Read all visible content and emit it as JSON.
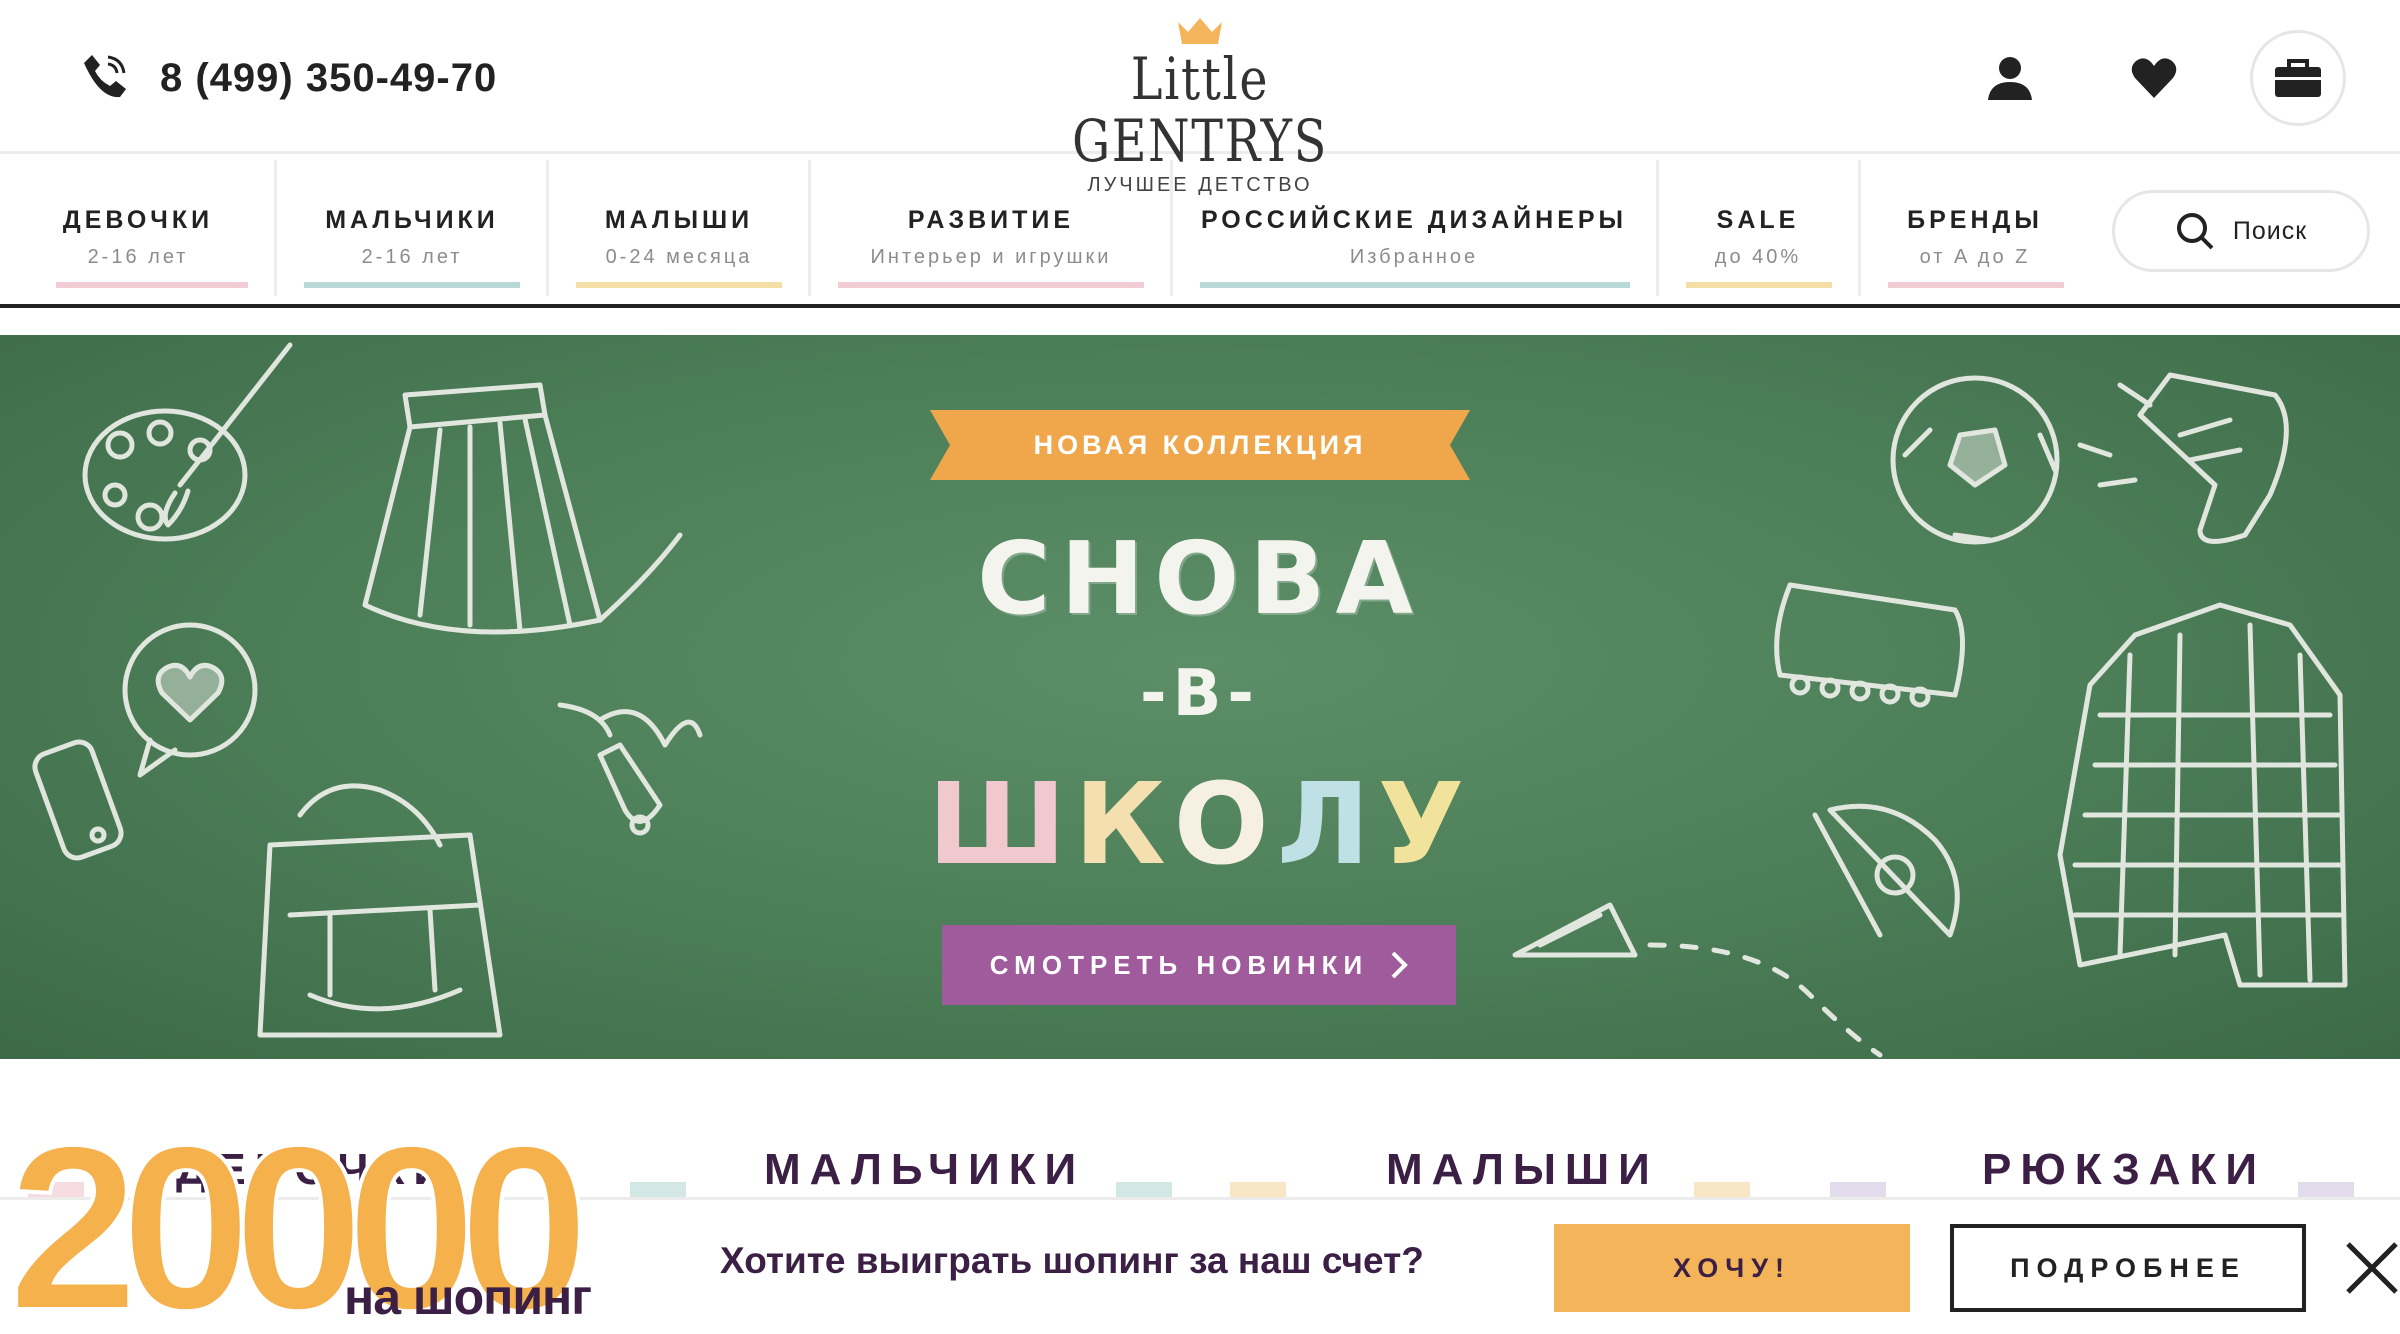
{
  "header": {
    "phone": "8 (499) 350-49-70",
    "logo_title": "Little GENTRYS",
    "logo_subtitle": "ЛУЧШЕЕ ДЕТСТВО",
    "icons": [
      "phone-icon",
      "crown-icon",
      "user-icon",
      "heart-icon",
      "bag-icon"
    ]
  },
  "nav": {
    "items": [
      {
        "title": "ДЕВОЧКИ",
        "sub": "2-16 лет",
        "color": "#f2cdd5"
      },
      {
        "title": "МАЛЬЧИКИ",
        "sub": "2-16 лет",
        "color": "#b9d9d6"
      },
      {
        "title": "МАЛЫШИ",
        "sub": "0-24 месяца",
        "color": "#f4dfa6"
      },
      {
        "title": "РАЗВИТИЕ",
        "sub": "Интерьер и игрушки",
        "color": "#f2cdd5"
      },
      {
        "title": "РОССИЙСКИЕ ДИЗАЙНЕРЫ",
        "sub": "Избранное",
        "color": "#b9d9d6"
      },
      {
        "title": "SALE",
        "sub": "до 40%",
        "color": "#f4dfa6"
      },
      {
        "title": "БРЕНДЫ",
        "sub": "от A до Z",
        "color": "#f2cdd5"
      }
    ],
    "search_label": "Поиск"
  },
  "hero": {
    "ribbon": "НОВАЯ КОЛЛЕКЦИЯ",
    "line1": "СНОВА",
    "line2": "-В-",
    "line3_letters": [
      "Ш",
      "К",
      "О",
      "Л",
      "У"
    ],
    "button": "СМОТРЕТЬ НОВИНКИ",
    "colors": {
      "board": "#4b7d57",
      "ribbon": "#f0a74c",
      "button": "#a05b9c"
    }
  },
  "categories": [
    "ДЕВОЧКИ",
    "МАЛЬЧИКИ",
    "МАЛЫШИ",
    "РЮКЗАКИ"
  ],
  "promo": {
    "amount": "20000",
    "amount_sub": "на шопинг",
    "question": "Хотите выиграть шопинг за наш счет?",
    "want_button": "ХОЧУ!",
    "more_button": "ПОДРОБНЕЕ",
    "colors": {
      "accent": "#f4b55a",
      "text": "#3b1f45"
    }
  }
}
